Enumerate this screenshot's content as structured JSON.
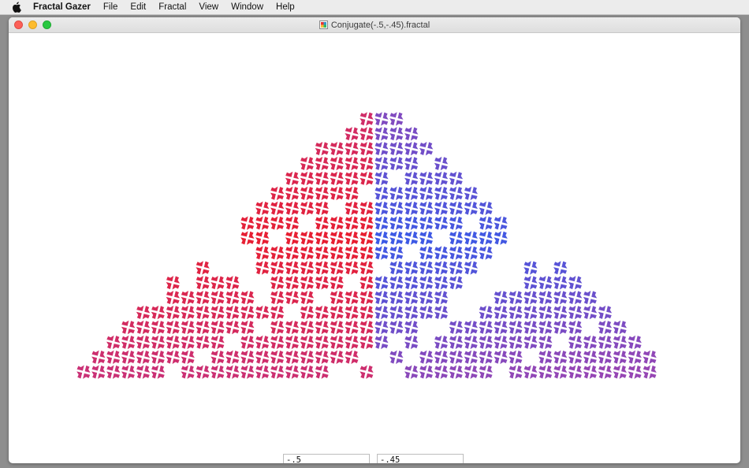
{
  "menubar": {
    "app_name": "Fractal Gazer",
    "items": [
      {
        "label": "File"
      },
      {
        "label": "Edit"
      },
      {
        "label": "Fractal"
      },
      {
        "label": "View"
      },
      {
        "label": "Window"
      },
      {
        "label": "Help"
      }
    ]
  },
  "window": {
    "title": "Conjugate(-.5,-.45).fractal"
  },
  "parameters": {
    "real": "-.5",
    "imag": "-.45"
  },
  "fractal": {
    "colors": {
      "red": "#e81e30",
      "magenta": "#c8327a",
      "purple": "#9646b4",
      "blue": "#3c5ae6"
    },
    "background": "#ffffff"
  }
}
